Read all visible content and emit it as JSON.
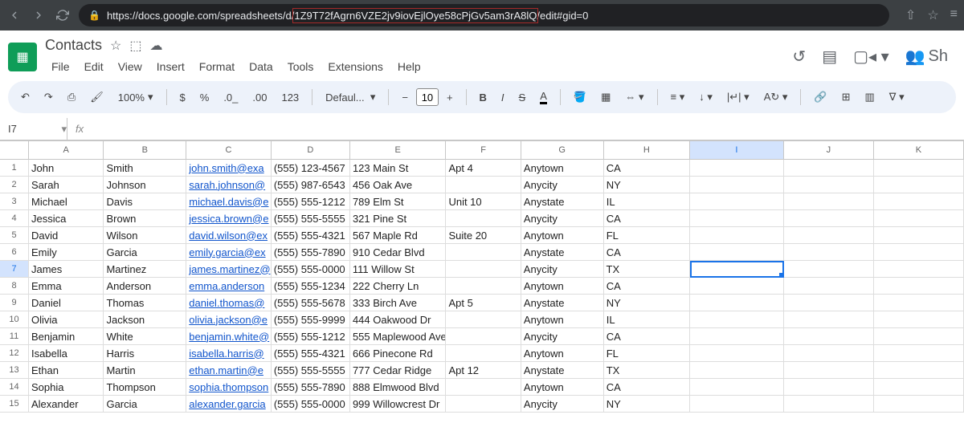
{
  "browser": {
    "url_prefix": "https://docs.google.com/spreadsheets/d/",
    "url_key": "1Z9T72fAgrn6VZE2jv9iovEjlOye58cPjGv5am3rA8lQ",
    "url_suffix": "/edit#gid=0"
  },
  "doc": {
    "title": "Contacts",
    "menus": [
      "File",
      "Edit",
      "View",
      "Insert",
      "Format",
      "Data",
      "Tools",
      "Extensions",
      "Help"
    ],
    "share_label": "Sh"
  },
  "toolbar": {
    "zoom": "100%",
    "currency": "$",
    "percent": "%",
    "dec_dec": ".0_",
    "dec_inc": ".00",
    "num_123": "123",
    "font_name": "Defaul...",
    "font_size": "10",
    "bold": "B",
    "italic": "I",
    "strike": "S",
    "text_color": "A"
  },
  "formula_bar": {
    "cell_ref": "I7",
    "fx": "fx"
  },
  "columns": [
    "A",
    "B",
    "C",
    "D",
    "E",
    "F",
    "G",
    "H",
    "I",
    "J",
    "K"
  ],
  "active_cell": {
    "row": 7,
    "col": "I"
  },
  "rows": [
    {
      "n": 1,
      "A": "John",
      "B": "Smith",
      "C": "john.smith@exa",
      "D": "(555) 123-4567",
      "E": "123 Main St",
      "F": "Apt 4",
      "G": "Anytown",
      "H": "CA"
    },
    {
      "n": 2,
      "A": "Sarah",
      "B": "Johnson",
      "C": "sarah.johnson@",
      "D": "(555) 987-6543",
      "E": "456 Oak Ave",
      "F": "",
      "G": "Anycity",
      "H": "NY"
    },
    {
      "n": 3,
      "A": "Michael",
      "B": "Davis",
      "C": "michael.davis@e",
      "D": "(555) 555-1212",
      "E": "789 Elm St",
      "F": "Unit 10",
      "G": "Anystate",
      "H": "IL"
    },
    {
      "n": 4,
      "A": "Jessica",
      "B": "Brown",
      "C": "jessica.brown@e",
      "D": "(555) 555-5555",
      "E": "321 Pine St",
      "F": "",
      "G": "Anycity",
      "H": "CA"
    },
    {
      "n": 5,
      "A": "David",
      "B": "Wilson",
      "C": "david.wilson@ex",
      "D": "(555) 555-4321",
      "E": "567 Maple Rd",
      "F": "Suite 20",
      "G": "Anytown",
      "H": "FL"
    },
    {
      "n": 6,
      "A": "Emily",
      "B": "Garcia",
      "C": "emily.garcia@ex",
      "D": "(555) 555-7890",
      "E": "910 Cedar Blvd",
      "F": "",
      "G": "Anystate",
      "H": "CA"
    },
    {
      "n": 7,
      "A": "James",
      "B": "Martinez",
      "C": "james.martinez@",
      "D": "(555) 555-0000",
      "E": "111 Willow St",
      "F": "",
      "G": "Anycity",
      "H": "TX"
    },
    {
      "n": 8,
      "A": "Emma",
      "B": "Anderson",
      "C": "emma.anderson",
      "D": "(555) 555-1234",
      "E": "222 Cherry Ln",
      "F": "",
      "G": "Anytown",
      "H": "CA"
    },
    {
      "n": 9,
      "A": "Daniel",
      "B": "Thomas",
      "C": "daniel.thomas@",
      "D": "(555) 555-5678",
      "E": "333 Birch Ave",
      "F": "Apt 5",
      "G": "Anystate",
      "H": "NY"
    },
    {
      "n": 10,
      "A": "Olivia",
      "B": "Jackson",
      "C": "olivia.jackson@e",
      "D": "(555) 555-9999",
      "E": "444 Oakwood Dr",
      "F": "",
      "G": "Anytown",
      "H": "IL"
    },
    {
      "n": 11,
      "A": "Benjamin",
      "B": "White",
      "C": "benjamin.white@",
      "D": "(555) 555-1212",
      "E": "555 Maplewood Ave",
      "F": "",
      "G": "Anycity",
      "H": "CA"
    },
    {
      "n": 12,
      "A": "Isabella",
      "B": "Harris",
      "C": "isabella.harris@",
      "D": "(555) 555-4321",
      "E": "666 Pinecone Rd",
      "F": "",
      "G": "Anytown",
      "H": "FL"
    },
    {
      "n": 13,
      "A": "Ethan",
      "B": "Martin",
      "C": "ethan.martin@e",
      "D": "(555) 555-5555",
      "E": "777 Cedar Ridge",
      "F": "Apt 12",
      "G": "Anystate",
      "H": "TX"
    },
    {
      "n": 14,
      "A": "Sophia",
      "B": "Thompson",
      "C": "sophia.thompson",
      "D": "(555) 555-7890",
      "E": "888 Elmwood Blvd",
      "F": "",
      "G": "Anytown",
      "H": "CA"
    },
    {
      "n": 15,
      "A": "Alexander",
      "B": "Garcia",
      "C": "alexander.garcia",
      "D": "(555) 555-0000",
      "E": "999 Willowcrest Dr",
      "F": "",
      "G": "Anycity",
      "H": "NY"
    }
  ]
}
